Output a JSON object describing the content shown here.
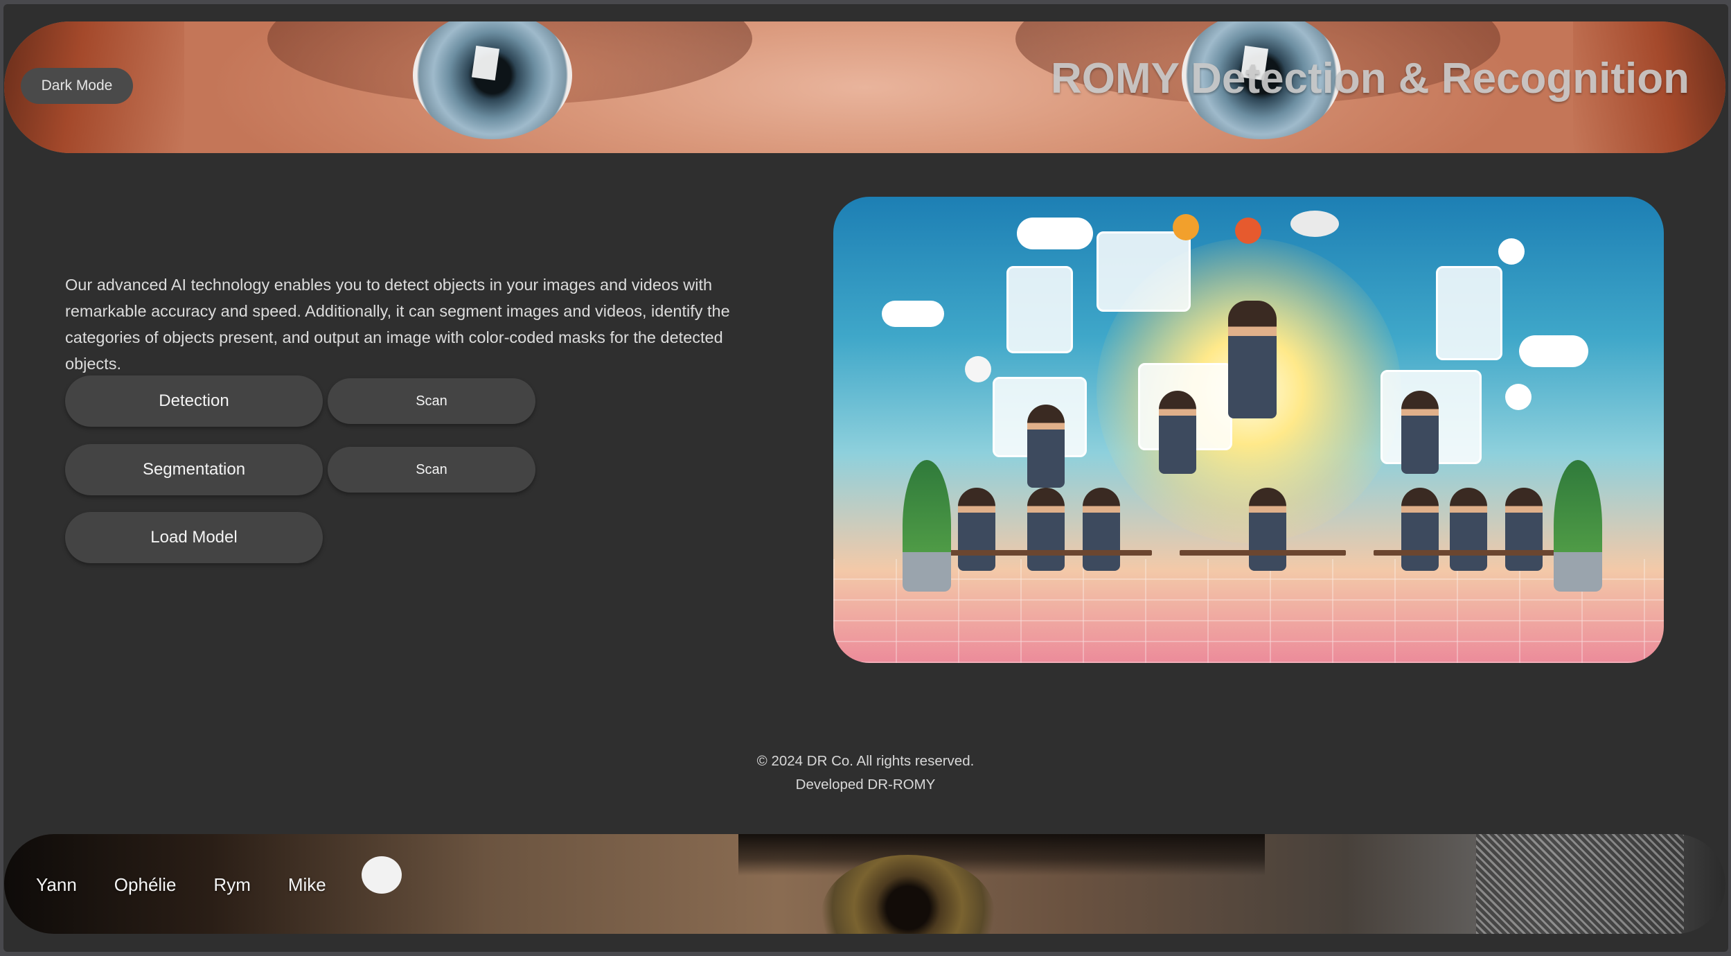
{
  "header": {
    "title": "ROMY Detection & Recognition",
    "dark_mode_label": "Dark Mode"
  },
  "main": {
    "description": "Our advanced AI technology enables you to detect objects in your images and videos with remarkable accuracy and speed. Additionally, it can segment images and videos, identify the categories of objects present, and output an image with color-coded masks for the detected objects.",
    "actions": {
      "detection_label": "Detection",
      "detection_scan_label": "Scan",
      "segmentation_label": "Segmentation",
      "segmentation_scan_label": "Scan",
      "load_model_label": "Load Model"
    }
  },
  "footer": {
    "copyright": "© 2024 DR Co. All rights reserved.",
    "developed": "Developed DR-ROMY",
    "team": [
      "Yann",
      "Ophélie",
      "Rym",
      "Mike"
    ]
  },
  "colors": {
    "page_background": "#2f2f2f",
    "button_background": "#444444",
    "text": "#dcdcdc"
  }
}
